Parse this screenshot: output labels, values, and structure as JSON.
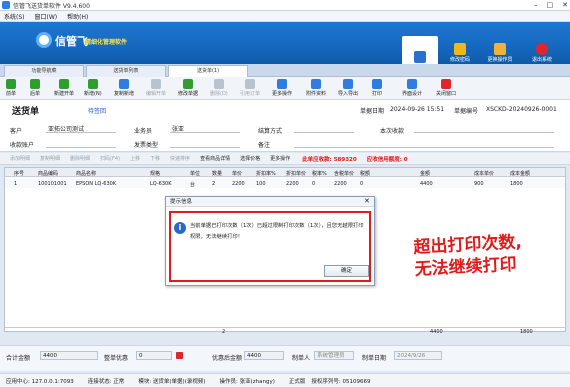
{
  "window": {
    "title": "信管飞送货单软件 V9.4.600"
  },
  "menu": {
    "items": [
      "系统(S)",
      "窗口(W)",
      "帮助(H)"
    ]
  },
  "brand": {
    "name": "信管飞",
    "tagline": "精细化管理软件"
  },
  "top_buttons": [
    {
      "label": "",
      "icon": "document-icon",
      "color": "#2b6fd0"
    },
    {
      "label": "修改密码",
      "icon": "lock-icon",
      "color": "#f2b51c"
    },
    {
      "label": "更换操作员",
      "icon": "users-icon",
      "color": "#f0b03a"
    },
    {
      "label": "退出系统",
      "icon": "exit-icon",
      "color": "#e0262b"
    }
  ],
  "tabs": [
    "功能导航菜",
    "送货单列表",
    "送货单(1)"
  ],
  "toolbar": [
    {
      "label": "前单",
      "icon": "prev-icon",
      "color": "#2f9d2f",
      "enabled": true
    },
    {
      "label": "后单",
      "icon": "next-icon",
      "color": "#2f9d2f",
      "enabled": true
    },
    {
      "label": "新建开单",
      "icon": "new-icon",
      "color": "#2f9d2f",
      "enabled": true
    },
    {
      "label": "新增(N)",
      "icon": "add-icon",
      "color": "#2f9d2f",
      "enabled": true
    },
    {
      "label": "复制新增",
      "icon": "copy-icon",
      "color": "#2f7de1",
      "enabled": true
    },
    {
      "label": "编辑开单",
      "icon": "edit-icon",
      "color": "#b9c3cf",
      "enabled": false
    },
    {
      "label": "修改单据",
      "icon": "modify-icon",
      "color": "#2f9d2f",
      "enabled": true
    },
    {
      "label": "删除(D)",
      "icon": "delete-icon",
      "color": "#b9c3cf",
      "enabled": false
    },
    {
      "label": "引用订单",
      "icon": "quote-icon",
      "color": "#b9c3cf",
      "enabled": false
    },
    {
      "label": "更多操作",
      "icon": "more-icon",
      "color": "#2f7de1",
      "enabled": true
    },
    {
      "label": "附件资料",
      "icon": "attach-icon",
      "color": "#2f7de1",
      "enabled": true
    },
    {
      "label": "导入导出",
      "icon": "import-export-icon",
      "color": "#2f7de1",
      "enabled": true
    },
    {
      "label": "打印",
      "icon": "print-icon",
      "color": "#2f7de1",
      "enabled": true
    },
    {
      "label": "界面设计",
      "icon": "design-icon",
      "color": "#2f7de1",
      "enabled": true
    },
    {
      "label": "关闭窗口",
      "icon": "close-window-icon",
      "color": "#e0262b",
      "enabled": true
    }
  ],
  "form": {
    "title": "送货单",
    "status": "待签回",
    "date_label": "单据日期",
    "date_value": "2024-09-26 15:51",
    "no_label": "单据编号",
    "no_value": "XSCKD-20240926-0001",
    "customer_label": "客户",
    "customer_value": "亚拓公司测试",
    "salesman_label": "业务员",
    "salesman_value": "张亚",
    "settle_label": "结算方式",
    "receive_label": "本次收款",
    "account_label": "收款账户",
    "invoice_label": "发票类型",
    "remark_label": "备注"
  },
  "subtoolbar": {
    "items": [
      {
        "label": "添加明细",
        "enabled": false
      },
      {
        "label": "复制明细",
        "enabled": false
      },
      {
        "label": "删除明细",
        "enabled": false
      },
      {
        "label": "扫码(F4)",
        "enabled": false
      },
      {
        "label": "上移",
        "enabled": false
      },
      {
        "label": "下移",
        "enabled": false
      },
      {
        "label": "快速排序",
        "enabled": false
      },
      {
        "label": "查看商品详情",
        "enabled": true
      },
      {
        "label": "选择价格",
        "enabled": true
      },
      {
        "label": "更多操作",
        "enabled": true
      }
    ],
    "receivable": "此单应收款: 589320",
    "credit": "应收信用额度: 0"
  },
  "grid": {
    "headers": [
      "序号",
      "商品编码",
      "商品名称",
      "规格",
      "单位",
      "数量",
      "单价",
      "折扣率%",
      "折扣单价",
      "税率%",
      "含税单价",
      "税额",
      "金额",
      "成本单价",
      "成本金额"
    ],
    "rows": [
      [
        "1",
        "100101001",
        "EPSON LQ-630K",
        "LQ-630K",
        "台",
        "2",
        "2200",
        "100",
        "2200",
        "0",
        "2200",
        "0",
        "4400",
        "900",
        "1800"
      ]
    ],
    "totals": {
      "qty": "2",
      "amount": "4400",
      "cost": "1800"
    }
  },
  "footer": {
    "total_label": "合计金额",
    "total_value": "4400",
    "discount_label": "整单优惠",
    "discount_value": "0",
    "after_label": "优惠后金额",
    "after_value": "4400",
    "maker_label": "制单人",
    "maker_value": "系统管理员",
    "makedate_label": "制单日期",
    "makedate_value": "2024/9/26"
  },
  "status": {
    "center": "应用中心: 127.0.0.1:7093",
    "conn": "连接状态: 正常",
    "tab": "模块: 送货单(单据)(录视频)",
    "user": "操作员: 张亚(zhangy)",
    "version": "正式版",
    "license": "授权序列号: 05109669"
  },
  "dialog": {
    "title": "提示信息",
    "message": "当前单据已打印次数（1次）已超过限制打印次数（1次），且您无越限打印权限，无法继续打印！",
    "ok": "确定"
  },
  "annotation": {
    "line1": "超出打印次数,",
    "line2": "无法继续打印"
  }
}
